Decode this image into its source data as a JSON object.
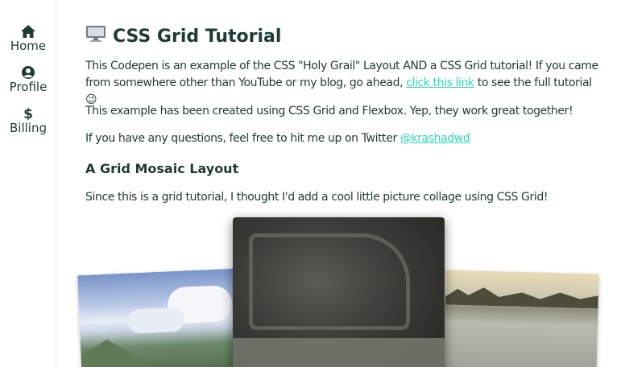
{
  "sidebar": {
    "items": [
      {
        "label": "Home",
        "icon": "home-icon"
      },
      {
        "label": "Profile",
        "icon": "user-circle-icon"
      },
      {
        "label": "Billing",
        "icon": "dollar-icon"
      }
    ]
  },
  "main": {
    "title_icon": "🖥️",
    "title": "CSS Grid Tutorial",
    "intro_before_link": "This Codepen is an example of the CSS \"Holy Grail\" Layout AND a CSS Grid tutorial! If you came from somewhere other than YouTube or my blog, go ahead, ",
    "intro_link": "click this link",
    "intro_after_link": " to see the full tutorial 😉",
    "flexbox_text": "This example has been created using CSS Grid and Flexbox. Yep, they work great together!",
    "twitter_before": "If you have any questions, feel free to hit me up on Twitter ",
    "twitter_link": "@krashadwd",
    "section_title": "A Grid Mosaic Layout",
    "section_text": "Since this is a grid tutorial, I thought I'd add a cool little picture collage using CSS Grid!"
  },
  "colors": {
    "text": "#1f3b33",
    "link": "#2bd9b5"
  }
}
